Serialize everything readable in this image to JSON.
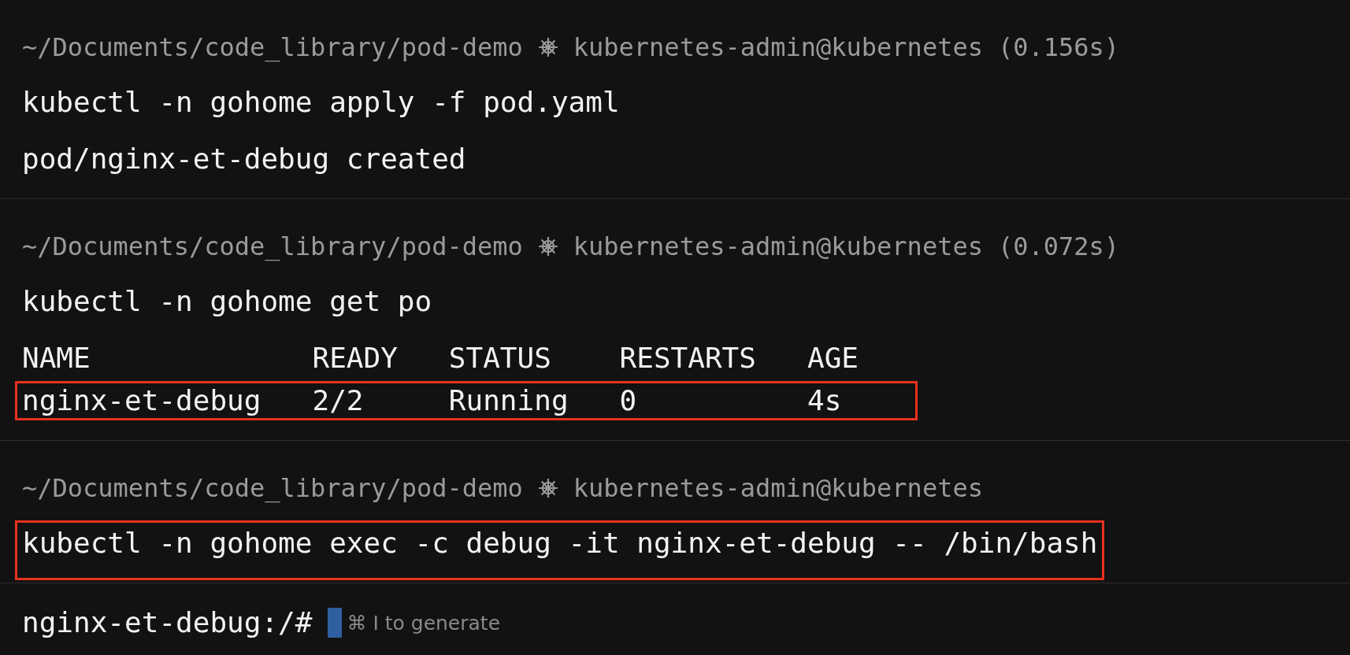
{
  "blocks": [
    {
      "prompt": {
        "path": "~/Documents/code_library/pod-demo",
        "context": "kubernetes-admin@kubernetes",
        "duration": "(0.156s)"
      },
      "command": {
        "text": "kubectl -n gohome apply -f pod.yaml",
        "highlighted": false
      },
      "output": [
        {
          "kind": "text",
          "text": "pod/nginx-et-debug created"
        }
      ]
    },
    {
      "prompt": {
        "path": "~/Documents/code_library/pod-demo",
        "context": "kubernetes-admin@kubernetes",
        "duration": "(0.072s)"
      },
      "command": {
        "text": "kubectl -n gohome get po",
        "highlighted": false
      },
      "output": [
        {
          "kind": "table",
          "columns": [
            "NAME",
            "READY",
            "STATUS",
            "RESTARTS",
            "AGE"
          ],
          "rows": [
            {
              "cells": [
                "nginx-et-debug",
                "2/2",
                "Running",
                "0",
                "4s"
              ],
              "highlighted": true
            }
          ]
        }
      ]
    },
    {
      "prompt": {
        "path": "~/Documents/code_library/pod-demo",
        "context": "kubernetes-admin@kubernetes"
      },
      "command": {
        "text": "kubectl -n gohome exec -c debug -it nginx-et-debug -- /bin/bash",
        "highlighted": true
      }
    }
  ],
  "active_prompt": {
    "prompt": "nginx-et-debug:/#",
    "placeholder": "⌘ I to generate"
  }
}
